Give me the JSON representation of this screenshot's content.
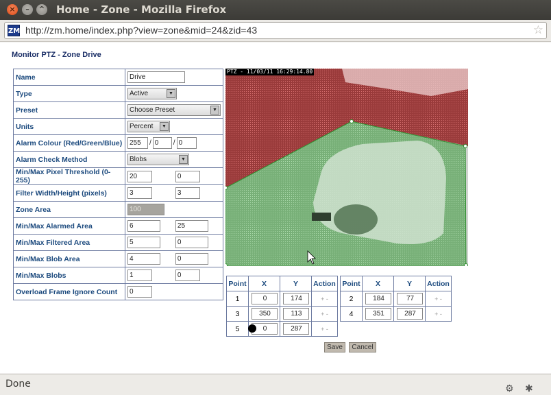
{
  "window": {
    "title": "Home - Zone - Mozilla Firefox"
  },
  "browser": {
    "url": "http://zm.home/index.php?view=zone&mid=24&zid=43",
    "site_icon_text": "ZM",
    "status": "Done"
  },
  "page": {
    "title": "Monitor PTZ - Zone Drive"
  },
  "form": {
    "name": {
      "label": "Name",
      "value": "Drive"
    },
    "type": {
      "label": "Type",
      "value": "Active"
    },
    "preset": {
      "label": "Preset",
      "value": "Choose Preset"
    },
    "units": {
      "label": "Units",
      "value": "Percent"
    },
    "alarm_colour": {
      "label": "Alarm Colour (Red/Green/Blue)",
      "r": "255",
      "g": "0",
      "b": "0",
      "sep": "/"
    },
    "check_method": {
      "label": "Alarm Check Method",
      "value": "Blobs"
    },
    "pixel_threshold": {
      "label": "Min/Max Pixel Threshold (0-255)",
      "min": "20",
      "max": "0"
    },
    "filter_size": {
      "label": "Filter Width/Height (pixels)",
      "min": "3",
      "max": "3"
    },
    "zone_area": {
      "label": "Zone Area",
      "value": "100"
    },
    "alarmed_area": {
      "label": "Min/Max Alarmed Area",
      "min": "6",
      "max": "25"
    },
    "filtered_area": {
      "label": "Min/Max Filtered Area",
      "min": "5",
      "max": "0"
    },
    "blob_area": {
      "label": "Min/Max Blob Area",
      "min": "4",
      "max": "0"
    },
    "blobs": {
      "label": "Min/Max Blobs",
      "min": "1",
      "max": "0"
    },
    "overload": {
      "label": "Overload Frame Ignore Count",
      "value": "0"
    }
  },
  "camera": {
    "timestamp": "PTZ - 11/03/11 16:29:14.80"
  },
  "points": {
    "headers": {
      "point": "Point",
      "x": "X",
      "y": "Y",
      "action": "Action"
    },
    "action_text": "+ -",
    "rows": [
      {
        "n": "1",
        "x": "0",
        "y": "174"
      },
      {
        "n": "2",
        "x": "184",
        "y": "77"
      },
      {
        "n": "3",
        "x": "350",
        "y": "113"
      },
      {
        "n": "4",
        "x": "351",
        "y": "287"
      },
      {
        "n": "5",
        "x": "0",
        "y": "287"
      }
    ]
  },
  "buttons": {
    "save": "Save",
    "cancel": "Cancel"
  }
}
